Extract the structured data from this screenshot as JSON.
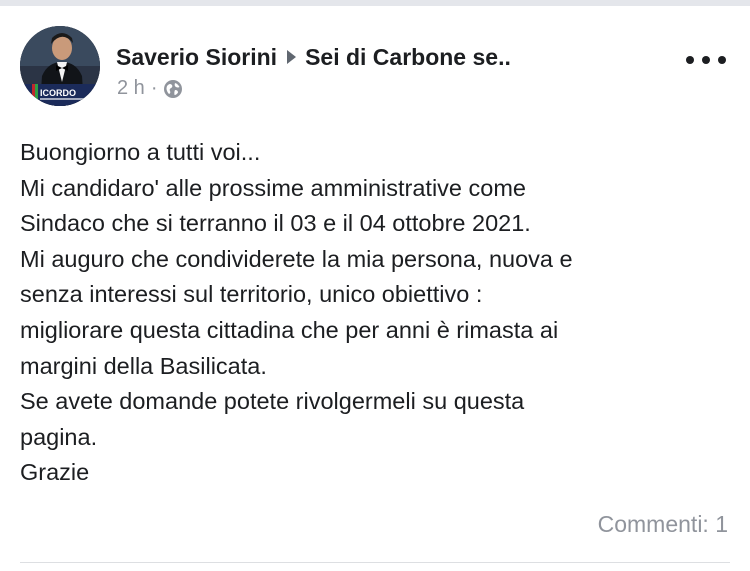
{
  "post": {
    "author": "Saverio Siorini",
    "group": "Sei di Carbone se..",
    "timestamp": "2 h",
    "separator": "·",
    "privacy_icon": "globe-icon",
    "avatar_logo_text": "ICORDO",
    "body_lines": [
      "Buongiorno a tutti voi...",
      "Mi candidaro' alle prossime amministrative come",
      "Sindaco che si terranno il 03 e il 04 ottobre 2021.",
      "Mi auguro che condividerete la mia persona, nuova e",
      "senza interessi sul territorio, unico obiettivo :",
      "migliorare questa cittadina che per anni è rimasta ai",
      "margini della Basilicata.",
      "Se avete domande potete rivolgermeli su questa",
      "pagina.",
      "Grazie"
    ],
    "comments_label": "Commenti: 1"
  },
  "colors": {
    "text": "#1c1e21",
    "secondary_text": "#90949c",
    "divider": "#dddfe2"
  },
  "icons": {
    "more": "more-options-icon",
    "arrow": "caret-right-icon"
  }
}
